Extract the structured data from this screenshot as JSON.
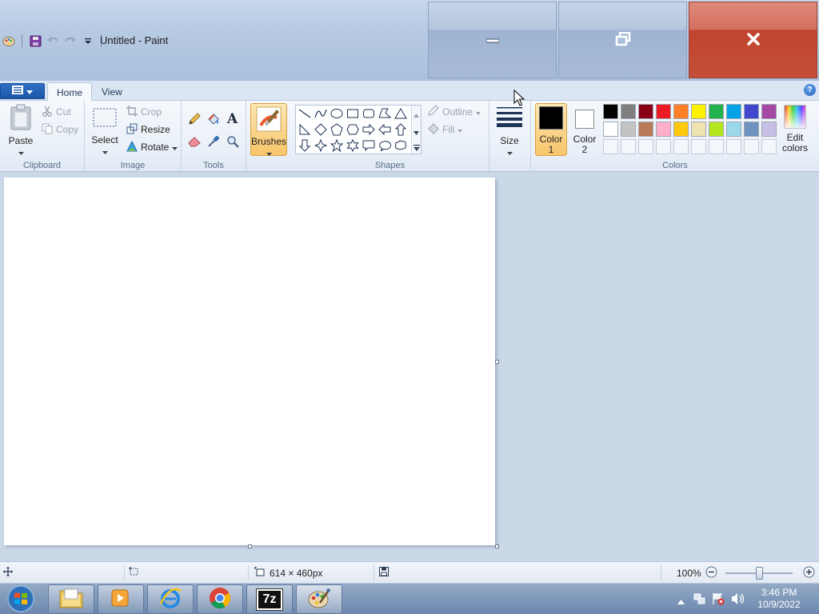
{
  "window": {
    "title": "Untitled - Paint"
  },
  "tabs": {
    "home": "Home",
    "view": "View"
  },
  "clipboard": {
    "label": "Clipboard",
    "paste": "Paste",
    "cut": "Cut",
    "copy": "Copy"
  },
  "image": {
    "label": "Image",
    "select": "Select",
    "crop": "Crop",
    "resize": "Resize",
    "rotate": "Rotate"
  },
  "tools": {
    "label": "Tools"
  },
  "brushes": {
    "label": "Brushes"
  },
  "shapes": {
    "label": "Shapes",
    "outline": "Outline",
    "fill": "Fill"
  },
  "size": {
    "label": "Size"
  },
  "colors": {
    "label": "Colors",
    "color1_line1": "Color",
    "color1_line2": "1",
    "color2_line1": "Color",
    "color2_line2": "2",
    "edit_line1": "Edit",
    "edit_line2": "colors",
    "color1": "#000000",
    "color2": "#ffffff",
    "palette_row1": [
      "#000000",
      "#7f7f7f",
      "#880015",
      "#ed1c24",
      "#ff7f27",
      "#fff200",
      "#22b14c",
      "#00a2e8",
      "#3f48cc",
      "#a349a4"
    ],
    "palette_row2": [
      "#ffffff",
      "#c3c3c3",
      "#b97a57",
      "#ffaec9",
      "#ffc90e",
      "#efe4b0",
      "#b5e61d",
      "#99d9ea",
      "#7092be",
      "#c8bfe7"
    ]
  },
  "status": {
    "canvas_size": "614 × 460px",
    "zoom": "100%"
  },
  "taskbar": {
    "time": "3:46 PM",
    "date": "10/9/2022",
    "seven_zip": "7z"
  }
}
